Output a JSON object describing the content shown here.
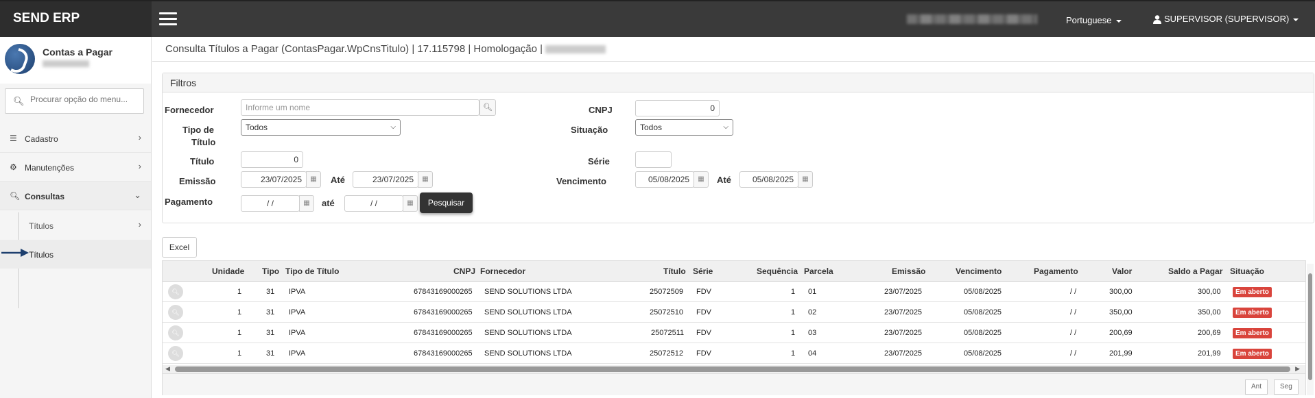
{
  "app": {
    "brand": "SEND ERP",
    "language": "Portuguese",
    "user": "SUPERVISOR (SUPERVISOR)"
  },
  "sidebar": {
    "title": "Contas a Pagar",
    "search_placeholder": "Procurar opção do menu...",
    "items": [
      {
        "label": "Cadastro",
        "icon": "list-icon"
      },
      {
        "label": "Manutenções",
        "icon": "gears-icon"
      },
      {
        "label": "Consultas",
        "icon": "search-icon"
      }
    ],
    "subitems": [
      {
        "label": "Títulos"
      },
      {
        "label": "Títulos"
      }
    ]
  },
  "page": {
    "title": "Consulta Títulos a Pagar (ContasPagar.WpCnsTitulo) | 17.115798 | Homologação |"
  },
  "filters": {
    "heading": "Filtros",
    "fornecedor_label": "Fornecedor",
    "fornecedor_placeholder": "Informe um nome",
    "cnpj_label": "CNPJ",
    "cnpj_value": "0",
    "tipo_label_1": "Tipo de",
    "tipo_label_2": "Título",
    "tipo_value": "Todos",
    "situacao_label": "Situação",
    "situacao_value": "Todos",
    "titulo_label": "Título",
    "titulo_value": "0",
    "serie_label": "Série",
    "serie_value": "",
    "emissao_label": "Emissão",
    "emissao_de": "23/07/2025",
    "ate_label": "Até",
    "emissao_ate": "23/07/2025",
    "vencimento_label": "Vencimento",
    "vencimento_de": "05/08/2025",
    "vencimento_ate": "05/08/2025",
    "pagamento_label": "Pagamento",
    "pagamento_de": "/ /",
    "ate_label_lower": "até",
    "pagamento_ate": "/ /",
    "search_button": "Pesquisar"
  },
  "excel_button": "Excel",
  "table": {
    "columns": [
      "Unidade",
      "Tipo",
      "Tipo de Título",
      "CNPJ",
      "Fornecedor",
      "Título",
      "Série",
      "Sequência",
      "Parcela",
      "Emissão",
      "Vencimento",
      "Pagamento",
      "Valor",
      "Saldo a Pagar",
      "Situação"
    ],
    "rows": [
      {
        "unidade": "1",
        "tipo": "31",
        "tipo_titulo": "IPVA",
        "cnpj": "67843169000265",
        "fornecedor": "SEND SOLUTIONS LTDA",
        "titulo": "25072509",
        "serie": "FDV",
        "sequencia": "1",
        "parcela": "01",
        "emissao": "23/07/2025",
        "vencimento": "05/08/2025",
        "pagamento": "/ /",
        "valor": "300,00",
        "saldo": "300,00",
        "situacao": "Em aberto"
      },
      {
        "unidade": "1",
        "tipo": "31",
        "tipo_titulo": "IPVA",
        "cnpj": "67843169000265",
        "fornecedor": "SEND SOLUTIONS LTDA",
        "titulo": "25072510",
        "serie": "FDV",
        "sequencia": "1",
        "parcela": "02",
        "emissao": "23/07/2025",
        "vencimento": "05/08/2025",
        "pagamento": "/ /",
        "valor": "350,00",
        "saldo": "350,00",
        "situacao": "Em aberto"
      },
      {
        "unidade": "1",
        "tipo": "31",
        "tipo_titulo": "IPVA",
        "cnpj": "67843169000265",
        "fornecedor": "SEND SOLUTIONS LTDA",
        "titulo": "25072511",
        "serie": "FDV",
        "sequencia": "1",
        "parcela": "03",
        "emissao": "23/07/2025",
        "vencimento": "05/08/2025",
        "pagamento": "/ /",
        "valor": "200,69",
        "saldo": "200,69",
        "situacao": "Em aberto"
      },
      {
        "unidade": "1",
        "tipo": "31",
        "tipo_titulo": "IPVA",
        "cnpj": "67843169000265",
        "fornecedor": "SEND SOLUTIONS LTDA",
        "titulo": "25072512",
        "serie": "FDV",
        "sequencia": "1",
        "parcela": "04",
        "emissao": "23/07/2025",
        "vencimento": "05/08/2025",
        "pagamento": "/ /",
        "valor": "201,99",
        "saldo": "201,99",
        "situacao": "Em aberto"
      }
    ],
    "pager": {
      "prev": "Ant",
      "next": "Seg"
    }
  },
  "colors": {
    "topbar": "#3a3a3a",
    "badge": "#d9443c",
    "button_dark": "#333333"
  }
}
